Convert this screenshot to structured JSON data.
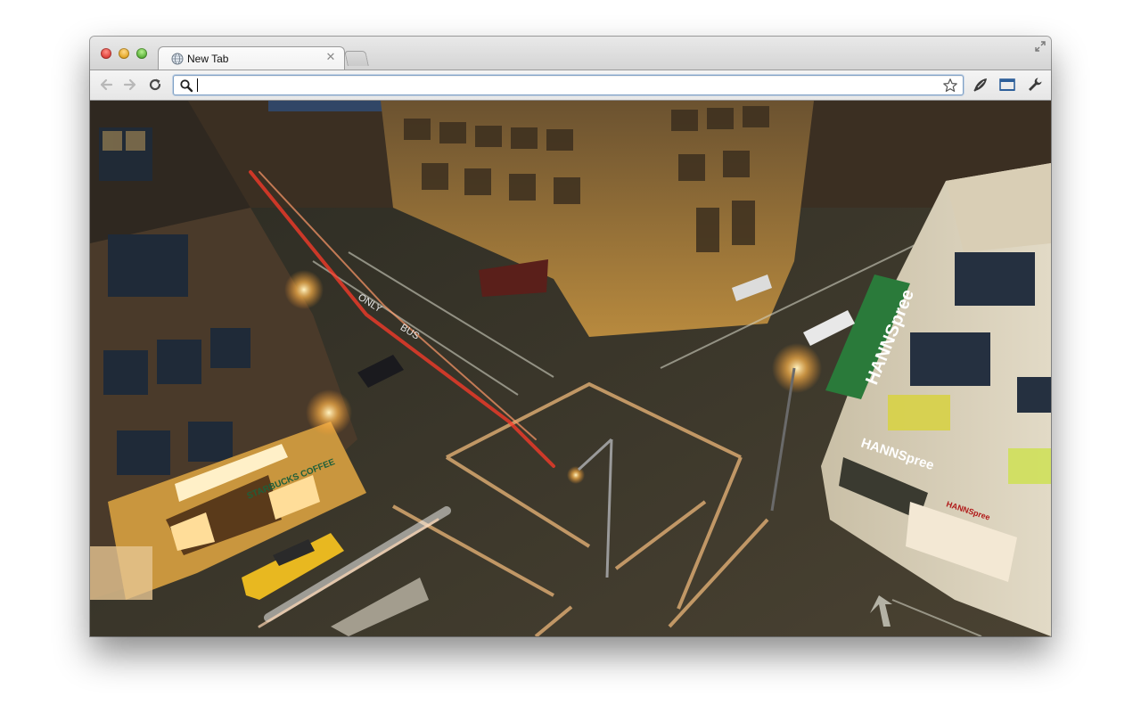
{
  "tabs": [
    {
      "title": "New Tab",
      "active": true
    }
  ],
  "omnibox": {
    "value": "",
    "placeholder": ""
  },
  "icons": {
    "back": "back-arrow-icon",
    "forward": "forward-arrow-icon",
    "reload": "reload-icon",
    "search": "search-icon",
    "bookmark": "star-icon",
    "extension": "extension-icon",
    "page_action": "page-icon",
    "settings": "wrench-icon",
    "fullscreen": "fullscreen-icon"
  },
  "colors": {
    "window_chrome": "#d8d8d8",
    "omnibox_focus": "#7fa1c6",
    "close_button": "#e0443e",
    "minimize_button": "#e5a92b",
    "maximize_button": "#5fb53e"
  },
  "content": {
    "signs": {
      "starbucks": "STARBUCKS COFFEE",
      "hannspree": "HANNSpree",
      "hannspree_store": "HANNSpree",
      "road_only": "ONLY",
      "road_bus": "BUS"
    }
  }
}
